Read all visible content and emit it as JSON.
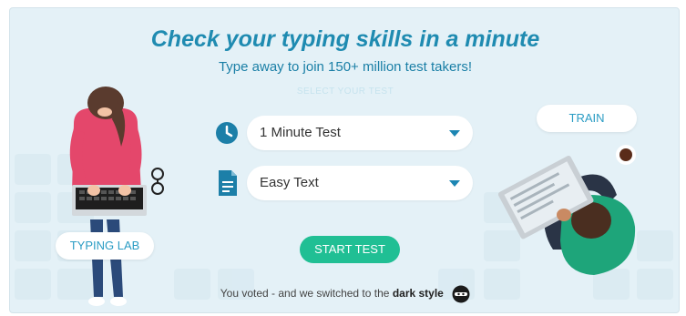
{
  "hero": {
    "headline": "Check your typing skills in a minute",
    "subline": "Type away to join 150+ million test takers!",
    "ghost_text": "SELECT YOUR TEST"
  },
  "controls": {
    "duration_select": {
      "value": "1 Minute Test",
      "icon": "clock-icon"
    },
    "text_select": {
      "value": "Easy Text",
      "icon": "document-icon"
    },
    "start_label": "START TEST"
  },
  "side_links": {
    "typing_lab": "TYPING LAB",
    "train": "TRAIN"
  },
  "footer": {
    "voted_prefix": "You voted - and we switched to the",
    "dark_style": "dark style",
    "ninja_icon": "ninja-icon"
  },
  "colors": {
    "accent": "#1f8bb1",
    "start_button": "#20bf94",
    "background": "#e4f1f7"
  }
}
